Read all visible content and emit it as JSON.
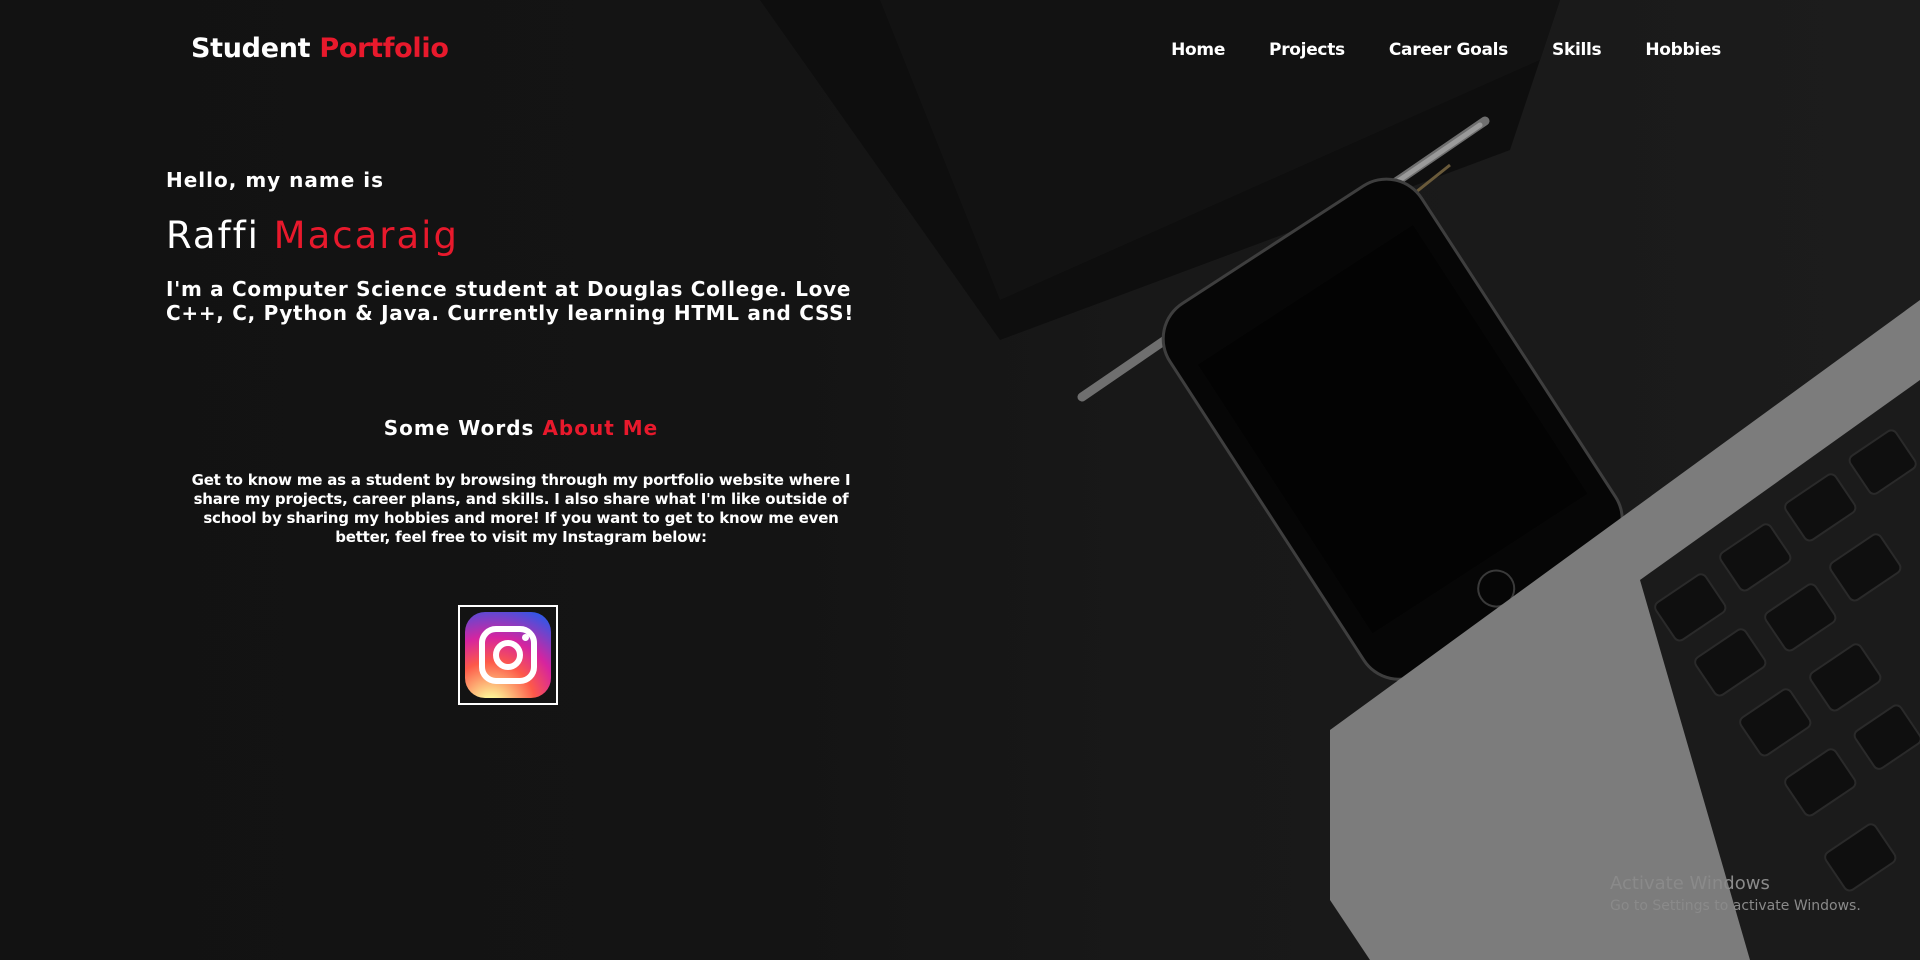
{
  "header": {
    "logo_main": "Student",
    "logo_accent": "Portfolio",
    "nav": [
      "Home",
      "Projects",
      "Career Goals",
      "Skills",
      "Hobbies"
    ]
  },
  "hero": {
    "greeting": "Hello, my name is",
    "first_name": "Raffi",
    "last_name": "Macaraig",
    "intro": "I'm a Computer Science student at Douglas College. Love C++, C, Python & Java. Currently learning HTML and CSS!"
  },
  "about": {
    "title_main": "Some Words",
    "title_accent": "About Me",
    "text": "Get to know me as a student by browsing through my portfolio website where I share my projects, career plans, and skills. I also share what I'm like outside of school by sharing my hobbies and more! If you want to get to know me even better, feel free to visit my Instagram below:"
  },
  "social": {
    "icon": "instagram-icon"
  },
  "watermark": {
    "title": "Activate Windows",
    "subtitle": "Go to Settings to activate Windows."
  },
  "colors": {
    "accent": "#e8192c",
    "background": "#121212",
    "text": "#ffffff"
  }
}
